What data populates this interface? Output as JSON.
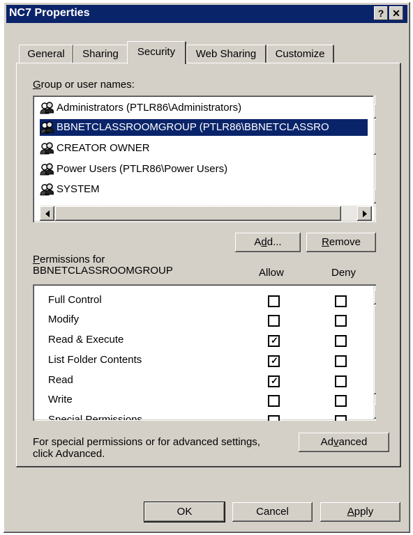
{
  "window": {
    "title": "NC7 Properties",
    "help_label": "?",
    "close_label": "✕"
  },
  "tabs": [
    {
      "label": "General",
      "active": false
    },
    {
      "label": "Sharing",
      "active": false
    },
    {
      "label": "Security",
      "active": true
    },
    {
      "label": "Web Sharing",
      "active": false
    },
    {
      "label": "Customize",
      "active": false
    }
  ],
  "groups": {
    "label_accel": "G",
    "label_rest": "roup or user names:",
    "items": [
      {
        "name": "Administrators (PTLR86\\Administrators)",
        "icon": "users-icon",
        "selected": false
      },
      {
        "name": "BBNETCLASSROOMGROUP (PTLR86\\BBNETCLASSRO",
        "icon": "users-icon",
        "selected": true
      },
      {
        "name": "CREATOR OWNER",
        "icon": "users-icon",
        "selected": false
      },
      {
        "name": "Power Users (PTLR86\\Power Users)",
        "icon": "users-icon",
        "selected": false
      },
      {
        "name": "SYSTEM",
        "icon": "users-icon",
        "selected": false
      }
    ]
  },
  "buttons": {
    "add_pre": "A",
    "add_accel": "d",
    "add_post": "d...",
    "remove_accel": "R",
    "remove_post": "emove",
    "advanced_pre": "Ad",
    "advanced_accel": "v",
    "advanced_post": "anced",
    "ok": "OK",
    "cancel": "Cancel",
    "apply_accel": "A",
    "apply_post": "pply"
  },
  "permissions": {
    "header_accel": "P",
    "header_rest": "ermissions for",
    "header_group": "BBNETCLASSROOMGROUP",
    "allow_label": "Allow",
    "deny_label": "Deny",
    "rows": [
      {
        "name": "Full Control",
        "allow": false,
        "deny": false
      },
      {
        "name": "Modify",
        "allow": false,
        "deny": false
      },
      {
        "name": "Read & Execute",
        "allow": true,
        "deny": false
      },
      {
        "name": "List Folder Contents",
        "allow": true,
        "deny": false
      },
      {
        "name": "Read",
        "allow": true,
        "deny": false
      },
      {
        "name": "Write",
        "allow": false,
        "deny": false
      },
      {
        "name": "Special Permissions",
        "allow": false,
        "deny": false
      }
    ]
  },
  "advanced_hint_line1": "For special permissions or for advanced settings,",
  "advanced_hint_line2": "click Advanced."
}
